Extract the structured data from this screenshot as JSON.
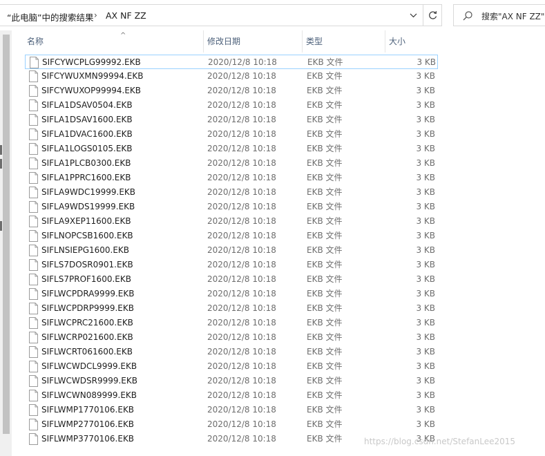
{
  "address_bar": {
    "location_label": "“此电脑”中的搜索结果",
    "separator": "›",
    "query_crumb": "AX NF ZZ"
  },
  "search": {
    "text": "搜索\"AX NF ZZ\""
  },
  "columns": {
    "name": "名称",
    "date": "修改日期",
    "type": "类型",
    "size": "大小",
    "sort_indicator": "^"
  },
  "files": [
    {
      "name": "SIFCYWCPLG99992.EKB",
      "date": "2020/12/8 10:18",
      "type": "EKB 文件",
      "size": "3 KB"
    },
    {
      "name": "SIFCYWUXMN99994.EKB",
      "date": "2020/12/8 10:18",
      "type": "EKB 文件",
      "size": "3 KB"
    },
    {
      "name": "SIFCYWUXOP99994.EKB",
      "date": "2020/12/8 10:18",
      "type": "EKB 文件",
      "size": "3 KB"
    },
    {
      "name": "SIFLA1DSAV0504.EKB",
      "date": "2020/12/8 10:18",
      "type": "EKB 文件",
      "size": "3 KB"
    },
    {
      "name": "SIFLA1DSAV1600.EKB",
      "date": "2020/12/8 10:18",
      "type": "EKB 文件",
      "size": "3 KB"
    },
    {
      "name": "SIFLA1DVAC1600.EKB",
      "date": "2020/12/8 10:18",
      "type": "EKB 文件",
      "size": "3 KB"
    },
    {
      "name": "SIFLA1LOGS0105.EKB",
      "date": "2020/12/8 10:18",
      "type": "EKB 文件",
      "size": "3 KB"
    },
    {
      "name": "SIFLA1PLCB0300.EKB",
      "date": "2020/12/8 10:18",
      "type": "EKB 文件",
      "size": "3 KB"
    },
    {
      "name": "SIFLA1PPRC1600.EKB",
      "date": "2020/12/8 10:18",
      "type": "EKB 文件",
      "size": "3 KB"
    },
    {
      "name": "SIFLA9WDC19999.EKB",
      "date": "2020/12/8 10:18",
      "type": "EKB 文件",
      "size": "3 KB"
    },
    {
      "name": "SIFLA9WDS19999.EKB",
      "date": "2020/12/8 10:18",
      "type": "EKB 文件",
      "size": "3 KB"
    },
    {
      "name": "SIFLA9XEP11600.EKB",
      "date": "2020/12/8 10:18",
      "type": "EKB 文件",
      "size": "3 KB"
    },
    {
      "name": "SIFLNOPCSB1600.EKB",
      "date": "2020/12/8 10:18",
      "type": "EKB 文件",
      "size": "3 KB"
    },
    {
      "name": "SIFLNSIEPG1600.EKB",
      "date": "2020/12/8 10:18",
      "type": "EKB 文件",
      "size": "3 KB"
    },
    {
      "name": "SIFLS7DOSR0901.EKB",
      "date": "2020/12/8 10:18",
      "type": "EKB 文件",
      "size": "3 KB"
    },
    {
      "name": "SIFLS7PROF1600.EKB",
      "date": "2020/12/8 10:18",
      "type": "EKB 文件",
      "size": "3 KB"
    },
    {
      "name": "SIFLWCPDRA9999.EKB",
      "date": "2020/12/8 10:18",
      "type": "EKB 文件",
      "size": "3 KB"
    },
    {
      "name": "SIFLWCPDRP9999.EKB",
      "date": "2020/12/8 10:18",
      "type": "EKB 文件",
      "size": "3 KB"
    },
    {
      "name": "SIFLWCPRC21600.EKB",
      "date": "2020/12/8 10:18",
      "type": "EKB 文件",
      "size": "3 KB"
    },
    {
      "name": "SIFLWCRP021600.EKB",
      "date": "2020/12/8 10:18",
      "type": "EKB 文件",
      "size": "3 KB"
    },
    {
      "name": "SIFLWCRT061600.EKB",
      "date": "2020/12/8 10:18",
      "type": "EKB 文件",
      "size": "3 KB"
    },
    {
      "name": "SIFLWCWDCL9999.EKB",
      "date": "2020/12/8 10:18",
      "type": "EKB 文件",
      "size": "3 KB"
    },
    {
      "name": "SIFLWCWDSR9999.EKB",
      "date": "2020/12/8 10:18",
      "type": "EKB 文件",
      "size": "3 KB"
    },
    {
      "name": "SIFLWCWN089999.EKB",
      "date": "2020/12/8 10:18",
      "type": "EKB 文件",
      "size": "3 KB"
    },
    {
      "name": "SIFLWMP1770106.EKB",
      "date": "2020/12/8 10:18",
      "type": "EKB 文件",
      "size": "3 KB"
    },
    {
      "name": "SIFLWMP2770106.EKB",
      "date": "2020/12/8 10:18",
      "type": "EKB 文件",
      "size": "3 KB"
    },
    {
      "name": "SIFLWMP3770106.EKB",
      "date": "2020/12/8 10:18",
      "type": "EKB 文件",
      "size": "3 KB"
    }
  ],
  "watermark": "https://blog.csdn.net/StefanLee2015",
  "colors": {
    "header_text": "#4c607a",
    "selection_border": "#99d1ff",
    "secondary_text": "#6d6d6d"
  }
}
